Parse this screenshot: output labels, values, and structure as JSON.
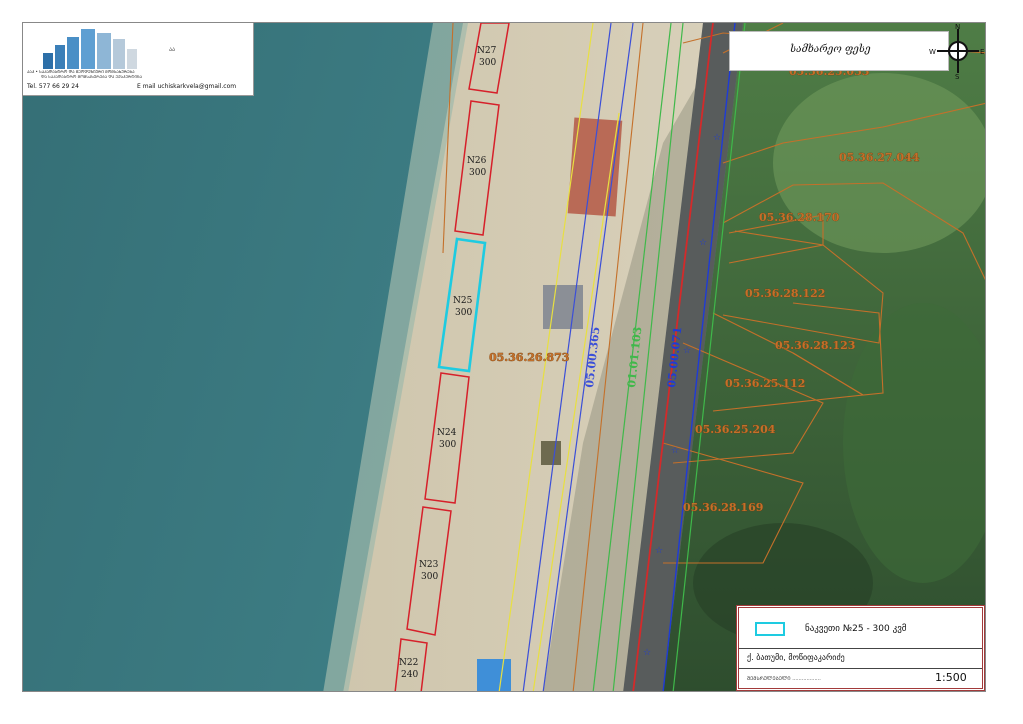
{
  "company": {
    "name_line": "ᲐᲐᲞ • ᲡᲐᲙᲐᲓᲐᲡᲢᲠᲝ ᲓᲐ ᲒᲔᲝᲓᲔᲖᲘᲣᲠᲘ ᲛᲝᲛᲡᲐᲮᲣᲠᲔᲑᲐ",
    "subtitle": "ᲓᲐ ᲡᲐᲙᲐᲓᲐᲡᲢᲠᲝ ᲛᲝᲛᲡᲐᲮᲣᲠᲔᲑᲐ ᲓᲐ ᲔᲥᲡᲞᲔᲠᲢᲘᲖᲐ",
    "tel": "Tel.   577 66 29 24",
    "email": "E mail   uchiskarkvela@gmail.com",
    "mark": "ᲐᲐ",
    "logo_color": "#2d6fa8"
  },
  "signature": "სამხარეო ფესე",
  "compass": {
    "n": "N",
    "s": "S",
    "e": "E",
    "w": "W"
  },
  "road_codes": [
    {
      "code": "05.00.365",
      "color": "#3b4fd8"
    },
    {
      "code": "01.01.103",
      "color": "#3fb84a"
    },
    {
      "code": "05.00.071",
      "color": "#1f3bd6"
    }
  ],
  "parcel_codes": [
    "05.36.25.033",
    "05.36.27.044",
    "05.36.28.170",
    "05.36.28.122",
    "05.36.28.123",
    "05.36.25.112",
    "05.36.25.204",
    "05.36.28.169",
    "05.36.26.873"
  ],
  "plots": [
    {
      "id": "N27",
      "area": "300",
      "highlight": false
    },
    {
      "id": "N26",
      "area": "300",
      "highlight": false
    },
    {
      "id": "N25",
      "area": "300",
      "highlight": true
    },
    {
      "id": "N24",
      "area": "300",
      "highlight": false
    },
    {
      "id": "N23",
      "area": "300",
      "highlight": false
    },
    {
      "id": "N22",
      "area": "240",
      "highlight": false
    }
  ],
  "legend": {
    "label": "ნაკვეთი №25 - 300 კვმ",
    "owner": "ქ. ბათუმი, მოწიფაკარიძე",
    "sign_line": "ᲨᲔᲛᲡᲠᲣᲚᲔᲑᲔᲚᲘ ..................",
    "scale": "1:500",
    "highlight_color": "#1ecbe1",
    "border_color": "#a23a3a"
  },
  "colors": {
    "sea": "#3e7f86",
    "plot_border": "#d6202a",
    "parcel_line": "#c4702a",
    "red_line": "#d42a2a"
  }
}
